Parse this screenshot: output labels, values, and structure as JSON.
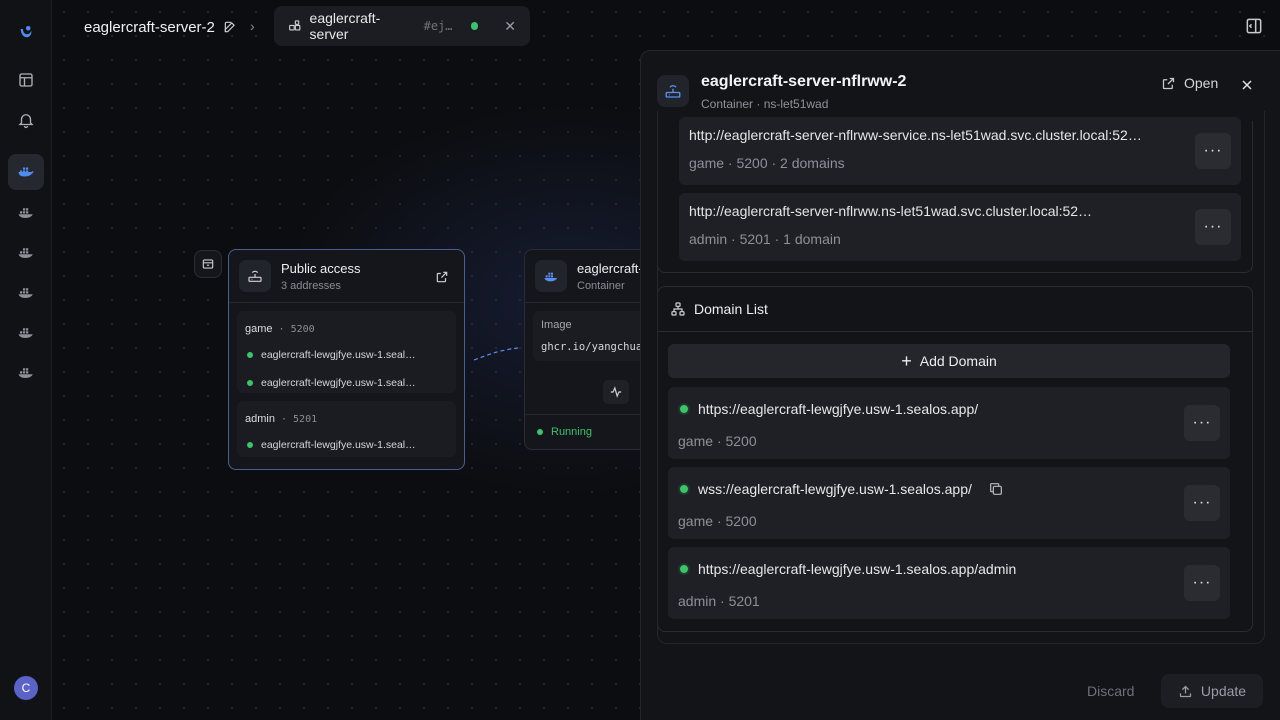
{
  "breadcrumb": {
    "project_title": "eaglercraft-server-2",
    "tab_label": "eaglercraft-server",
    "tab_hash": "#ej…"
  },
  "public_access_node": {
    "title": "Public access",
    "subtitle": "3 addresses",
    "ports": [
      {
        "name": "game",
        "port": "5200",
        "domains": [
          "eaglercraft-lewgjfye.usw-1.seal…",
          "eaglercraft-lewgjfye.usw-1.seal…"
        ]
      },
      {
        "name": "admin",
        "port": "5201",
        "domains": [
          "eaglercraft-lewgjfye.usw-1.seal…"
        ]
      }
    ]
  },
  "container_node": {
    "title": "eaglercraft-s",
    "subtitle": "Container",
    "image_label": "Image",
    "image_value": "ghcr.io/yangchua",
    "status": "Running"
  },
  "panel": {
    "title": "eaglercraft-server-nflrww-2",
    "subtitle": "Container · ns-let51wad",
    "open_label": "Open",
    "services": [
      {
        "url": "http://eaglercraft-server-nflrww-service.ns-let51wad.svc.cluster.local:52…",
        "meta": "game · 5200 · 2 domains"
      },
      {
        "url": "http://eaglercraft-server-nflrww.ns-let51wad.svc.cluster.local:52…",
        "meta": "admin · 5201 · 1 domain"
      }
    ],
    "domain_list": {
      "title": "Domain List",
      "add_label": "Add Domain",
      "items": [
        {
          "url": "https://eaglercraft-lewgjfye.usw-1.sealos.app/",
          "meta": "game · 5200"
        },
        {
          "url": "wss://eaglercraft-lewgjfye.usw-1.sealos.app/",
          "meta": "game · 5200"
        },
        {
          "url": "https://eaglercraft-lewgjfye.usw-1.sealos.app/admin",
          "meta": "admin · 5201"
        }
      ]
    },
    "discard_label": "Discard",
    "update_label": "Update"
  },
  "user": {
    "initial": "C"
  },
  "colors": {
    "accent": "#4f8cf0",
    "status_green": "#3ec26b",
    "avatar": "#5b63c6"
  }
}
